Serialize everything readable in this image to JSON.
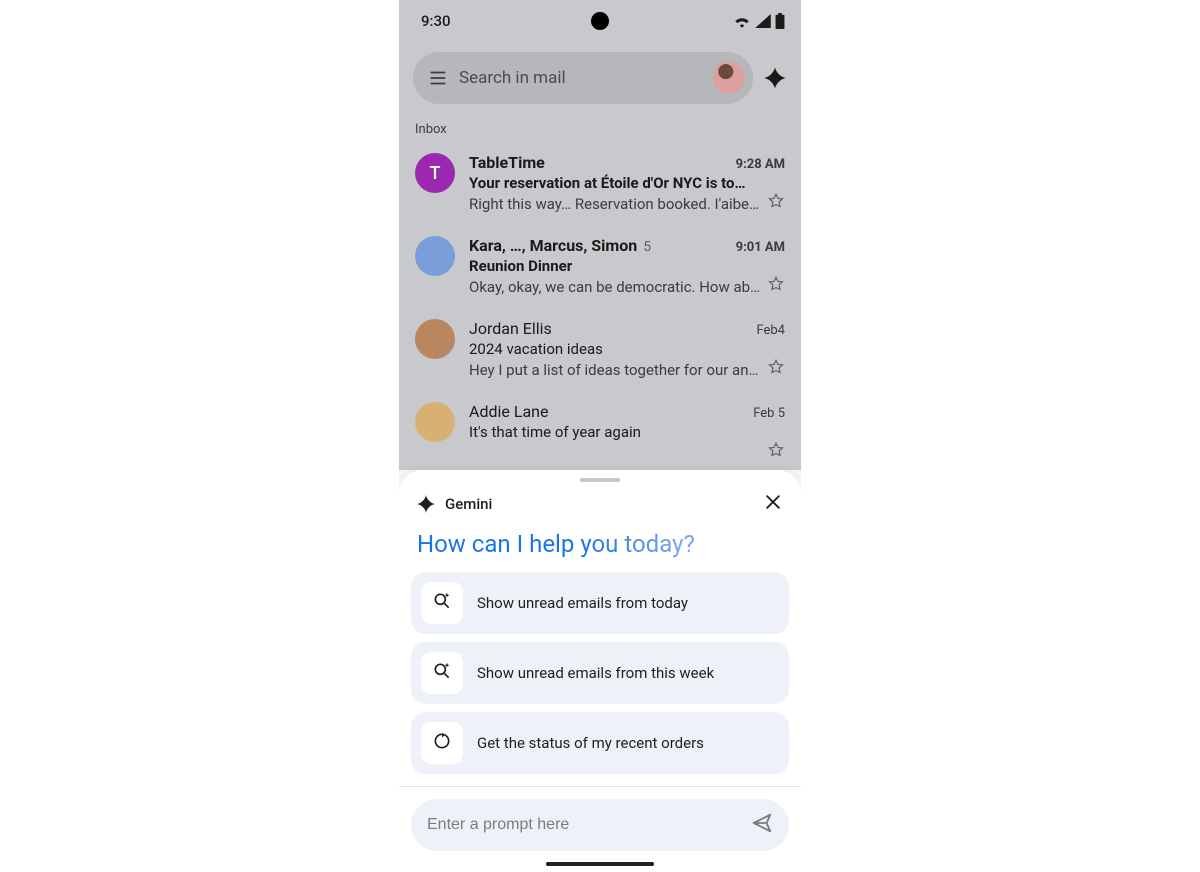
{
  "statusbar": {
    "time": "9:30"
  },
  "search": {
    "placeholder": "Search in mail"
  },
  "section_label": "Inbox",
  "emails": [
    {
      "sender": "TableTime",
      "time": "9:28 AM",
      "subject": "Your reservation at Étoile d'Or NYC is to…",
      "snippet": "Right this way… Reservation booked. I'aibell…",
      "unread": true,
      "avatar_letter": "T",
      "avatar_class": "purple"
    },
    {
      "sender": "Kara, …, Marcus, Simon",
      "count": "5",
      "time": "9:01 AM",
      "subject": "Reunion Dinner",
      "snippet": "Okay, okay, we can be democratic. How abo…",
      "unread": true,
      "avatar_class": "photo1"
    },
    {
      "sender": "Jordan Ellis",
      "time": "Feb4",
      "subject": "2024 vacation ideas",
      "snippet": "Hey I put a list of ideas together for our an…",
      "unread": false,
      "avatar_class": "photo2"
    },
    {
      "sender": "Addie Lane",
      "time": "Feb 5",
      "subject": "It's that time of year again",
      "snippet": "",
      "unread": false,
      "avatar_class": "photo3"
    }
  ],
  "sheet": {
    "title": "Gemini",
    "headline": "How can I help you today?",
    "suggestions": [
      {
        "label": "Show unread emails from today",
        "icon": "sparkle-search"
      },
      {
        "label": "Show unread emails from this week",
        "icon": "sparkle-search"
      },
      {
        "label": "Get the status of my recent orders",
        "icon": "refresh"
      }
    ],
    "input_placeholder": "Enter a prompt here"
  }
}
